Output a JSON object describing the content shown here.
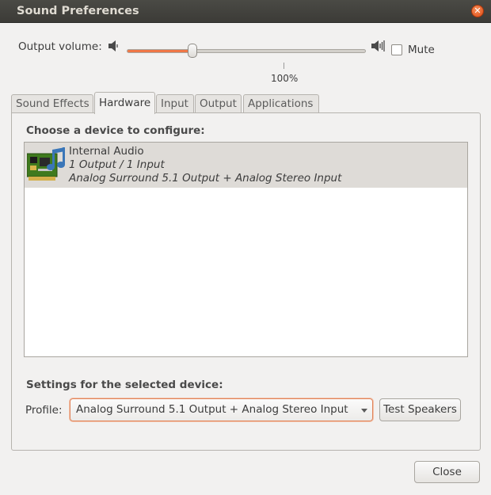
{
  "window": {
    "title": "Sound Preferences",
    "close_icon": "close-icon"
  },
  "volume": {
    "label": "Output volume:",
    "value_percent": 28,
    "scale_label": "100%",
    "mute_label": "Mute",
    "mute_checked": false
  },
  "tabs": [
    {
      "label": "Sound Effects",
      "active": false
    },
    {
      "label": "Hardware",
      "active": true
    },
    {
      "label": "Input",
      "active": false
    },
    {
      "label": "Output",
      "active": false
    },
    {
      "label": "Applications",
      "active": false
    }
  ],
  "hardware": {
    "choose_heading": "Choose a device to configure:",
    "devices": [
      {
        "name": "Internal Audio",
        "io": "1 Output / 1 Input",
        "profile": "Analog Surround 5.1 Output + Analog Stereo Input",
        "icon": "sound-card-icon"
      }
    ],
    "settings_heading": "Settings for the selected device:",
    "profile_label": "Profile:",
    "profile_value": "Analog Surround 5.1 Output + Analog Stereo Input",
    "test_button": "Test Speakers"
  },
  "footer": {
    "close_button": "Close"
  },
  "colors": {
    "accent": "#f07746",
    "titlebar": "#3c3b37",
    "selection": "#dedbd7"
  }
}
